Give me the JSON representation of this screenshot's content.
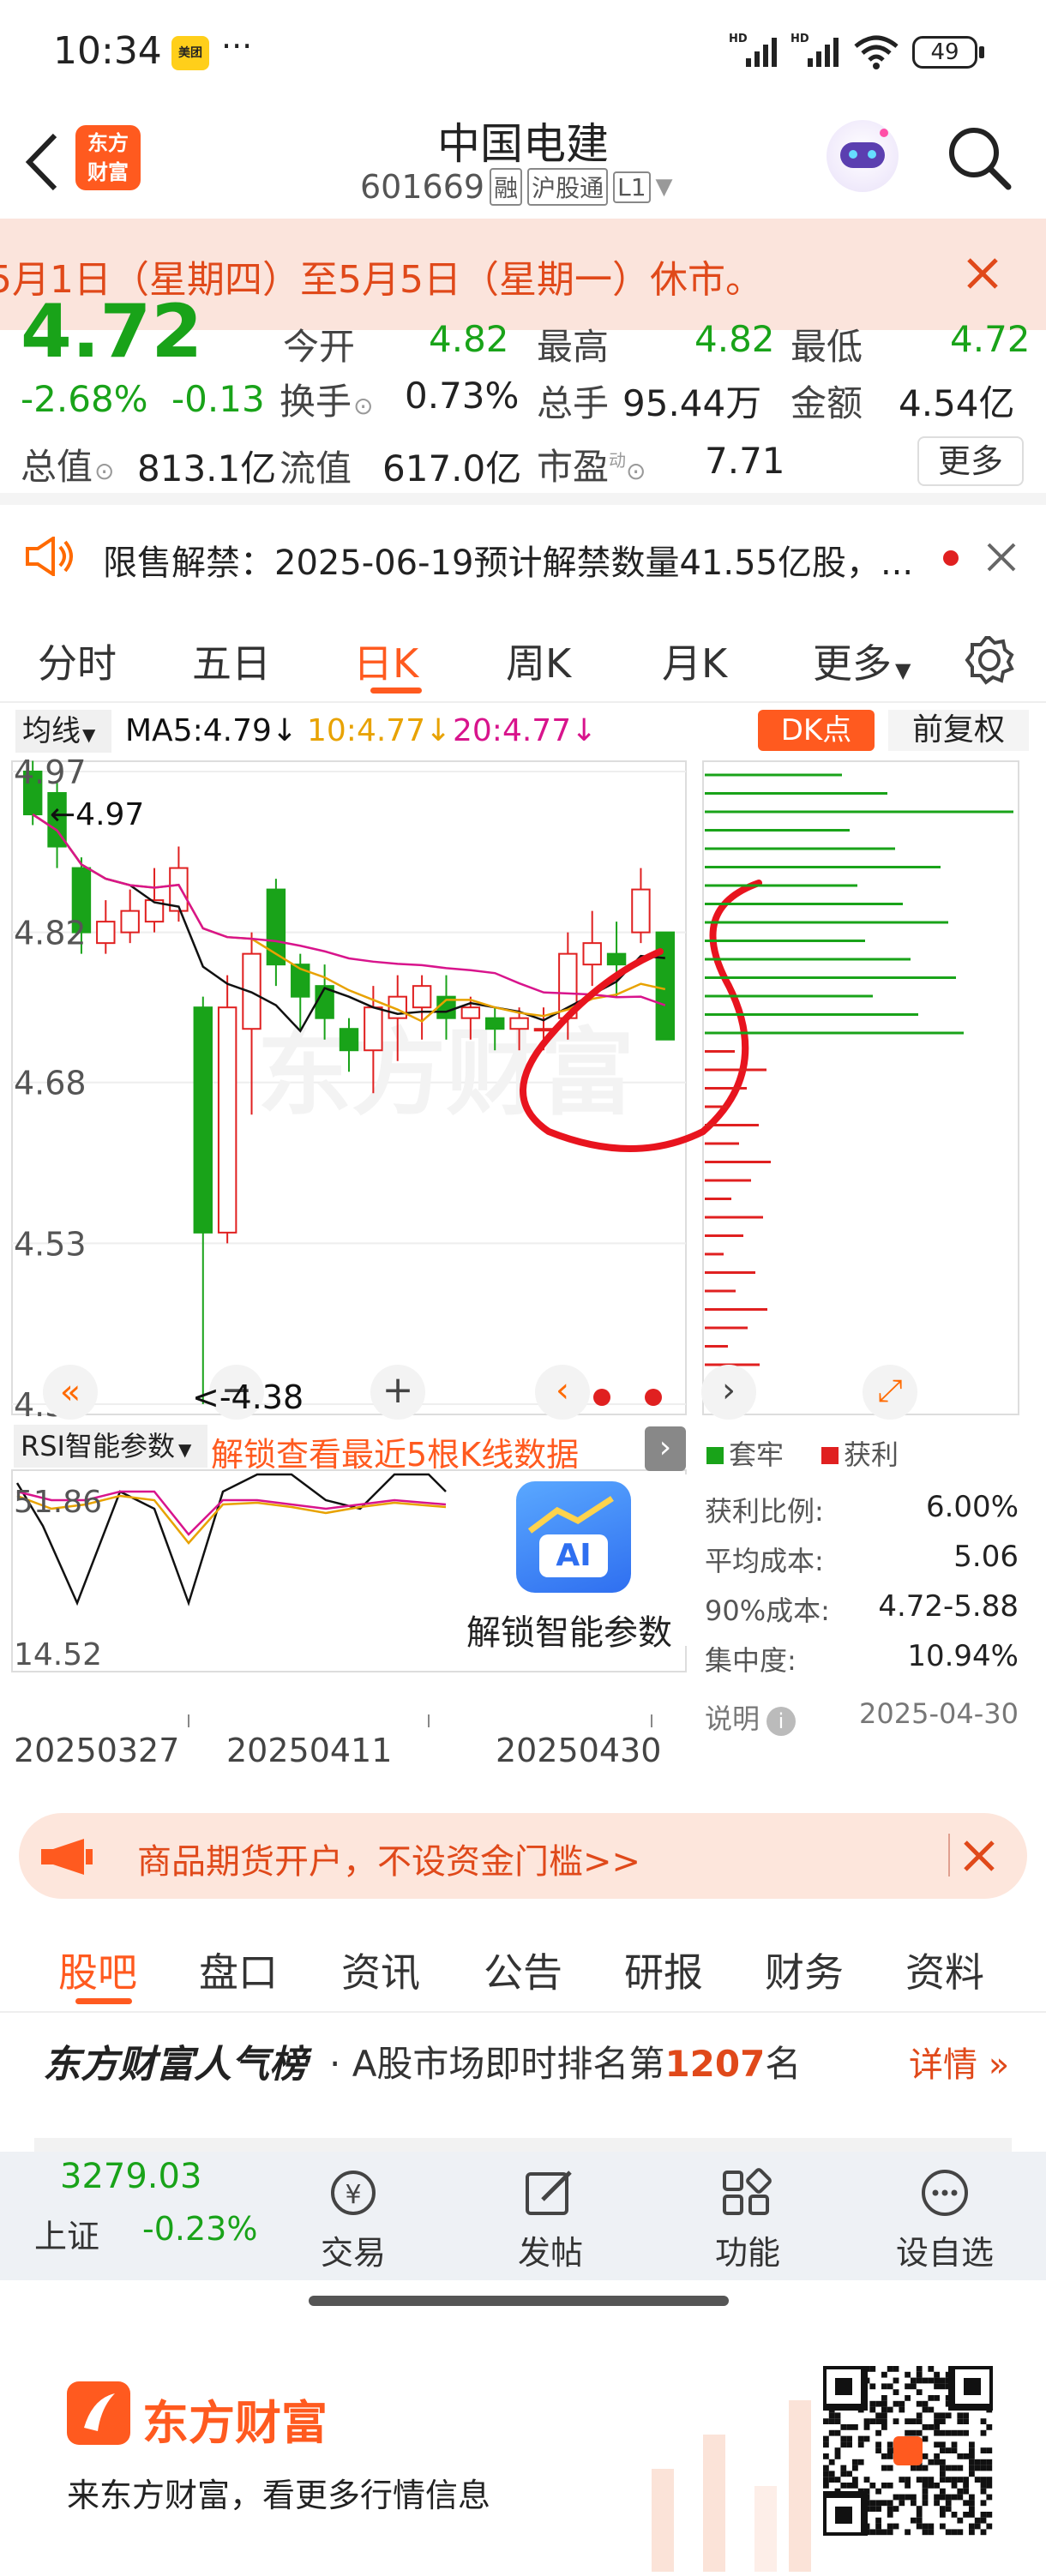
{
  "status_bar": {
    "time": "10:34",
    "app_badge": "美团",
    "dots": "···",
    "net1": "HD",
    "net2": "HD",
    "battery": "49"
  },
  "header": {
    "title": "中国电建",
    "code": "601669",
    "tag1": "融",
    "tag2": "沪股通",
    "tag3": "L1"
  },
  "notice": {
    "text": "5月1日（星期四）至5月5日（星期一）休市。"
  },
  "quote": {
    "price": "4.72",
    "open_label": "今开",
    "open_value": "4.82",
    "high_label": "最高",
    "high_value": "4.82",
    "low_label": "最低",
    "low_value": "4.72",
    "change_pct": "-2.68%",
    "change": "-0.13",
    "turnover_label": "换手",
    "turnover_value": "0.73%",
    "volume_label": "总手",
    "volume_value": "95.44万",
    "amount_label": "金额",
    "amount_value": "4.54亿",
    "mktcap_label": "总值",
    "mktcap_value": "813.1亿",
    "float_label": "流值",
    "float_value": "617.0亿",
    "pe_label": "市盈",
    "pe_sup": "动",
    "pe_value": "7.71",
    "more_btn": "更多"
  },
  "unlock": {
    "text": "限售解禁：2025-06-19预计解禁数量41.55亿股，..."
  },
  "period_tabs": [
    {
      "label": "分时"
    },
    {
      "label": "五日"
    },
    {
      "label": "日K"
    },
    {
      "label": "周K"
    },
    {
      "label": "月K"
    },
    {
      "label": "更多"
    }
  ],
  "ma_strip": {
    "mode": "均线",
    "ma5": "MA5:4.79",
    "ma10": "10:4.77",
    "ma20": "20:4.77",
    "dk": "DK点",
    "adjust": "前复权"
  },
  "chart_data": {
    "type": "candlestick",
    "y_ticks": [
      "4.97",
      "4.82",
      "4.68",
      "4.53",
      "4.38"
    ],
    "ylim": [
      4.38,
      4.97
    ],
    "high_label": "4.97",
    "low_label": "<-4.38",
    "candles": [
      {
        "o": 4.97,
        "c": 4.93,
        "h": 4.98,
        "l": 4.92
      },
      {
        "o": 4.95,
        "c": 4.9,
        "h": 4.96,
        "l": 4.88
      },
      {
        "o": 4.88,
        "c": 4.82,
        "h": 4.89,
        "l": 4.8
      },
      {
        "o": 4.81,
        "c": 4.83,
        "h": 4.85,
        "l": 4.8
      },
      {
        "o": 4.82,
        "c": 4.84,
        "h": 4.86,
        "l": 4.81
      },
      {
        "o": 4.83,
        "c": 4.85,
        "h": 4.88,
        "l": 4.82
      },
      {
        "o": 4.84,
        "c": 4.88,
        "h": 4.9,
        "l": 4.83
      },
      {
        "o": 4.75,
        "c": 4.54,
        "h": 4.76,
        "l": 4.38
      },
      {
        "o": 4.54,
        "c": 4.75,
        "h": 4.78,
        "l": 4.53
      },
      {
        "o": 4.73,
        "c": 4.8,
        "h": 4.82,
        "l": 4.65
      },
      {
        "o": 4.86,
        "c": 4.79,
        "h": 4.87,
        "l": 4.77
      },
      {
        "o": 4.79,
        "c": 4.76,
        "h": 4.8,
        "l": 4.73
      },
      {
        "o": 4.77,
        "c": 4.74,
        "h": 4.79,
        "l": 4.72
      },
      {
        "o": 4.73,
        "c": 4.71,
        "h": 4.74,
        "l": 4.69
      },
      {
        "o": 4.71,
        "c": 4.75,
        "h": 4.77,
        "l": 4.67
      },
      {
        "o": 4.74,
        "c": 4.76,
        "h": 4.78,
        "l": 4.7
      },
      {
        "o": 4.75,
        "c": 4.77,
        "h": 4.78,
        "l": 4.72
      },
      {
        "o": 4.76,
        "c": 4.74,
        "h": 4.78,
        "l": 4.72
      },
      {
        "o": 4.74,
        "c": 4.75,
        "h": 4.76,
        "l": 4.72
      },
      {
        "o": 4.74,
        "c": 4.73,
        "h": 4.75,
        "l": 4.71
      },
      {
        "o": 4.73,
        "c": 4.74,
        "h": 4.75,
        "l": 4.71
      },
      {
        "o": 4.73,
        "c": 4.73,
        "h": 4.75,
        "l": 4.71
      },
      {
        "o": 4.74,
        "c": 4.8,
        "h": 4.82,
        "l": 4.72
      },
      {
        "o": 4.79,
        "c": 4.81,
        "h": 4.84,
        "l": 4.77
      },
      {
        "o": 4.8,
        "c": 4.79,
        "h": 4.83,
        "l": 4.76
      },
      {
        "o": 4.82,
        "c": 4.86,
        "h": 4.88,
        "l": 4.81
      },
      {
        "o": 4.82,
        "c": 4.72,
        "h": 4.82,
        "l": 4.72
      }
    ],
    "ma_colors": {
      "ma5": "#111111",
      "ma10": "#e8a200",
      "ma20": "#d8148c"
    },
    "up_color": "#e02020",
    "down_color": "#19a319"
  },
  "chip_panel": {
    "legend_locked": "套牢",
    "legend_profit": "获利",
    "rows": [
      {
        "label": "获利比例:",
        "value": "6.00%"
      },
      {
        "label": "平均成本:",
        "value": "5.06"
      },
      {
        "label": "90%成本:",
        "value": "4.72-5.88"
      },
      {
        "label": "集中度:",
        "value": "10.94%"
      }
    ],
    "note_label": "说明",
    "date": "2025-04-30"
  },
  "rsi": {
    "label": "RSI智能参数",
    "unlock_text": "解锁查看最近5根K线数据",
    "y_top": "51.86",
    "y_bottom": "14.52",
    "ai_text": "解锁智能参数",
    "ai_badge": "AI",
    "dates": [
      "20250327",
      "20250411",
      "20250430"
    ]
  },
  "ad": {
    "text": "商品期货开户，不设资金门槛>>"
  },
  "feature_tabs": [
    {
      "label": "股吧"
    },
    {
      "label": "盘口"
    },
    {
      "label": "资讯"
    },
    {
      "label": "公告"
    },
    {
      "label": "研报"
    },
    {
      "label": "财务"
    },
    {
      "label": "资料"
    }
  ],
  "rank": {
    "brand": "东方财富人气榜",
    "text": "· A股市场即时排名第",
    "rank_num": "1207",
    "unit": "名",
    "detail": "详情"
  },
  "bottom_nav": {
    "index_value": "3279.03",
    "index_name": "上证",
    "index_change": "-0.23%",
    "items": [
      {
        "label": "交易"
      },
      {
        "label": "发帖"
      },
      {
        "label": "功能"
      },
      {
        "label": "设自选"
      }
    ]
  },
  "promo": {
    "brand": "东方财富",
    "text": "来东方财富，看更多行情信息"
  },
  "colors": {
    "accent": "#ff6a00",
    "red": "#e02020",
    "green": "#19a319"
  }
}
